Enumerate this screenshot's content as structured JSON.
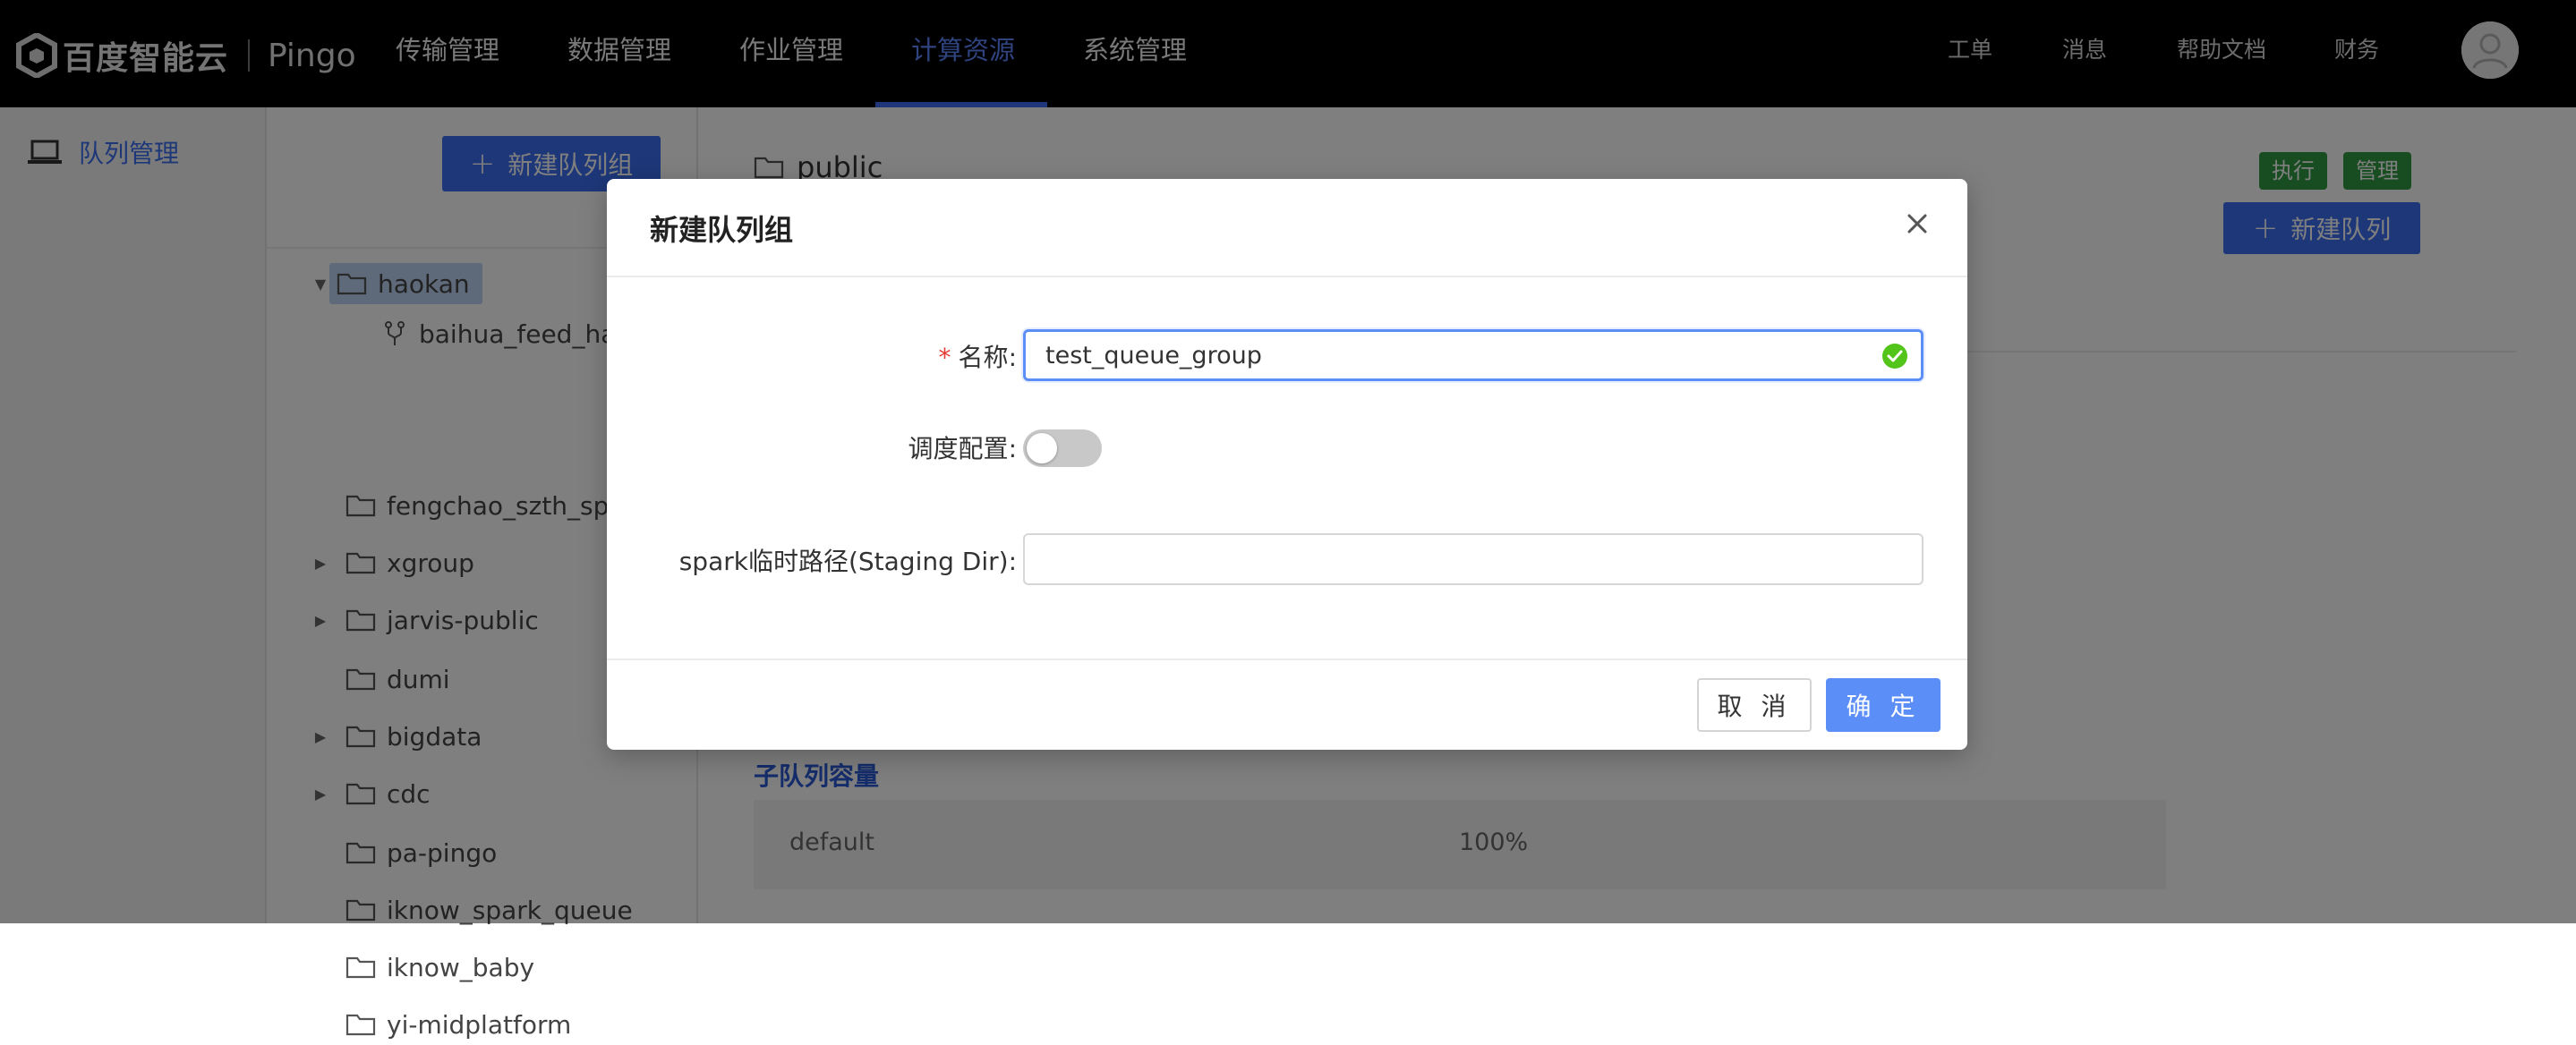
{
  "header": {
    "brand": "百度智能云",
    "product": "Pingo",
    "nav": [
      "传输管理",
      "数据管理",
      "作业管理",
      "计算资源",
      "系统管理"
    ],
    "active_nav": "计算资源",
    "right_links": [
      "工单",
      "消息",
      "帮助文档",
      "财务"
    ],
    "icons": {
      "logo": "baidu-cloud-logo-icon",
      "avatar": "user-avatar-icon"
    }
  },
  "sidebar": {
    "items": [
      {
        "label": "队列管理",
        "icon": "laptop-icon"
      }
    ]
  },
  "tree": {
    "new_group_label": "新建队列组",
    "nodes": [
      {
        "label": "haokan",
        "expanded": true,
        "selected": true
      },
      {
        "label": "baihua_feed_haok",
        "child": true,
        "icon": "branch-icon"
      },
      {
        "label": "fengchao_szth_spar"
      },
      {
        "label": "xgroup",
        "collapsed": true
      },
      {
        "label": "jarvis-public",
        "collapsed": true
      },
      {
        "label": "dumi"
      },
      {
        "label": "bigdata",
        "collapsed": true
      },
      {
        "label": "cdc",
        "collapsed": true
      },
      {
        "label": "pa-pingo"
      },
      {
        "label": "iknow_spark_queue"
      },
      {
        "label": "iknow_baby"
      },
      {
        "label": "yi-midplatform"
      }
    ]
  },
  "main": {
    "crumb": "public",
    "tags": [
      "执行",
      "管理"
    ],
    "new_queue_label": "新建队列",
    "sub_capacity_title": "子队列容量",
    "capacity_rows": [
      {
        "name": "default",
        "value": "100%"
      }
    ]
  },
  "modal": {
    "title": "新建队列组",
    "fields": {
      "name_label": "名称",
      "name_value": "test_queue_group",
      "schedule_label": "调度配置",
      "schedule_enabled": false,
      "staging_label": "spark临时路径(Staging Dir)",
      "staging_value": ""
    },
    "cancel_label": "取 消",
    "ok_label": "确 定"
  },
  "colors": {
    "primary": "#3a6ef0",
    "primary_light": "#5b8ef7",
    "tag_green": "#2f9a43",
    "valid_green": "#52c41a",
    "required_red": "#e53935"
  }
}
